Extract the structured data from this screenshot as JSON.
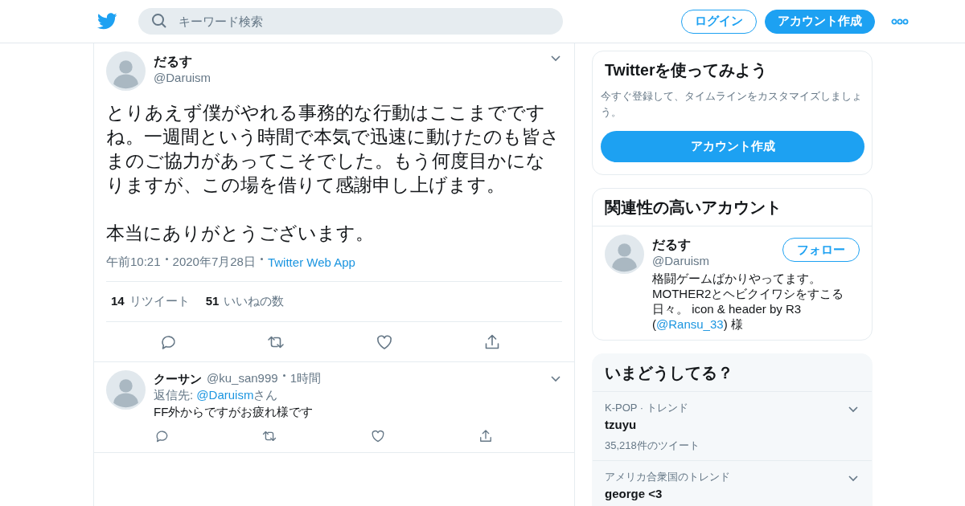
{
  "header": {
    "search": {
      "placeholder": "キーワード検索"
    },
    "login": "ログイン",
    "signup": "アカウント作成"
  },
  "tweet": {
    "name": "だるす",
    "handle": "@Daruism",
    "paragraphs": [
      "とりあえず僕がやれる事務的な行動はここまでですね。一週間という時間で本気で迅速に動けたのも皆さまのご協力があってこそでした。もう何度目かになりますが、この場を借りて感謝申し上げます。",
      "本当にありがとうございます。"
    ],
    "time": "午前10:21",
    "date": "2020年7月28日",
    "source": "Twitter Web App",
    "stats": [
      {
        "count": "14",
        "label": "リツイート"
      },
      {
        "count": "51",
        "label": "いいねの数"
      }
    ]
  },
  "replies": [
    {
      "name": "クーサン",
      "handle": "@ku_san999",
      "time": "1時間",
      "reply_prefix": "返信先: ",
      "reply_to": "@Daruism",
      "reply_suffix": "さん",
      "text": "FF外からですがお疲れ様です"
    }
  ],
  "signup_card": {
    "title": "Twitterを使ってみよう",
    "text": "今すぐ登録して、タイムラインをカスタマイズしましょう。",
    "button": "アカウント作成"
  },
  "related": {
    "title": "関連性の高いアカウント",
    "accounts": [
      {
        "name": "だるす",
        "handle": "@Daruism",
        "follow": "フォロー",
        "bio_before": "格闘ゲームばかりやってます。MOTHER2とヘビクイワシをすこる日々。 icon & header by R3 (",
        "bio_link": "@Ransu_33",
        "bio_after": ") 様"
      }
    ]
  },
  "trends": {
    "title": "いまどうしてる？",
    "items": [
      {
        "context": "K-POP · トレンド",
        "name": "tzuyu",
        "count": "35,218件のツイート"
      },
      {
        "context": "アメリカ合衆国のトレンド",
        "name": "george <3"
      }
    ]
  }
}
